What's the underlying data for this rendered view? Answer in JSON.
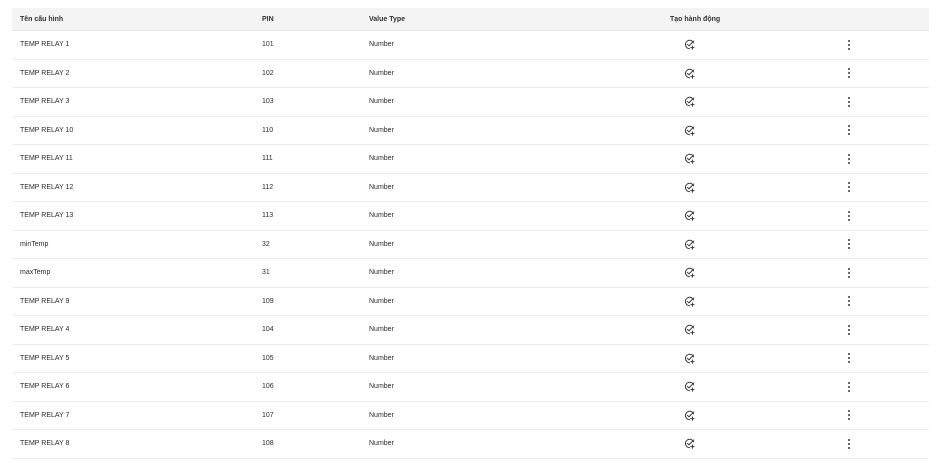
{
  "columns": {
    "name": "Tên cấu hình",
    "pin": "PIN",
    "value_type": "Value Type",
    "action": "Tạo hành động"
  },
  "rows": [
    {
      "name": "TEMP RELAY 1",
      "pin": "101",
      "value_type": "Number"
    },
    {
      "name": "TEMP RELAY 2",
      "pin": "102",
      "value_type": "Number"
    },
    {
      "name": "TEMP RELAY 3",
      "pin": "103",
      "value_type": "Number"
    },
    {
      "name": "TEMP RELAY 10",
      "pin": "110",
      "value_type": "Number"
    },
    {
      "name": "TEMP RELAY 11",
      "pin": "111",
      "value_type": "Number"
    },
    {
      "name": "TEMP RELAY 12",
      "pin": "112",
      "value_type": "Number"
    },
    {
      "name": "TEMP RELAY 13",
      "pin": "113",
      "value_type": "Number"
    },
    {
      "name": "minTemp",
      "pin": "32",
      "value_type": "Number"
    },
    {
      "name": "maxTemp",
      "pin": "31",
      "value_type": "Number"
    },
    {
      "name": "TEMP RELAY 9",
      "pin": "109",
      "value_type": "Number"
    },
    {
      "name": "TEMP RELAY 4",
      "pin": "104",
      "value_type": "Number"
    },
    {
      "name": "TEMP RELAY 5",
      "pin": "105",
      "value_type": "Number"
    },
    {
      "name": "TEMP RELAY 6",
      "pin": "106",
      "value_type": "Number"
    },
    {
      "name": "TEMP RELAY 7",
      "pin": "107",
      "value_type": "Number"
    },
    {
      "name": "TEMP RELAY 8",
      "pin": "108",
      "value_type": "Number"
    }
  ],
  "icons": {
    "action": "check-circle-plus-icon",
    "menu": "more-vertical-icon"
  },
  "colors": {
    "header_bg": "#f4f4f4",
    "row_border": "#ececec",
    "icon": "#3a3a3a"
  }
}
